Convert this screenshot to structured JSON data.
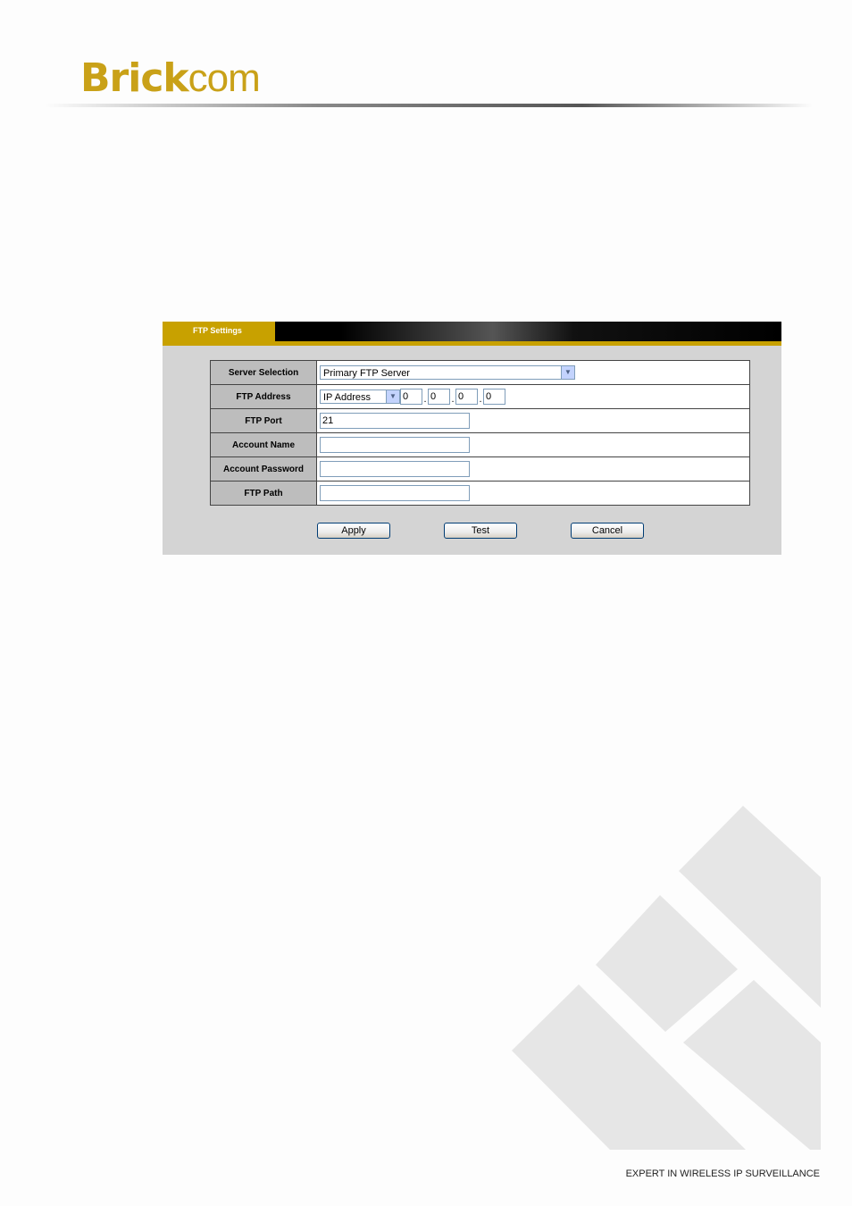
{
  "brand": {
    "bold": "Brick",
    "light": "com",
    "color": "#c9a118"
  },
  "footer": {
    "tagline": "EXPERT IN WIRELESS IP SURVEILLANCE"
  },
  "panel": {
    "tab_label": "FTP Settings",
    "accent": "#c8a100",
    "rows": {
      "server_selection": {
        "label": "Server Selection",
        "value": "Primary FTP Server"
      },
      "ftp_address": {
        "label": "FTP Address",
        "type_value": "IP Address",
        "octets": [
          "0",
          "0",
          "0",
          "0"
        ]
      },
      "ftp_port": {
        "label": "FTP Port",
        "value": "21"
      },
      "account_name": {
        "label": "Account Name",
        "value": ""
      },
      "account_password": {
        "label": "Account Password",
        "value": ""
      },
      "ftp_path": {
        "label": "FTP Path",
        "value": ""
      }
    },
    "buttons": {
      "apply": "Apply",
      "test": "Test",
      "cancel": "Cancel"
    }
  }
}
